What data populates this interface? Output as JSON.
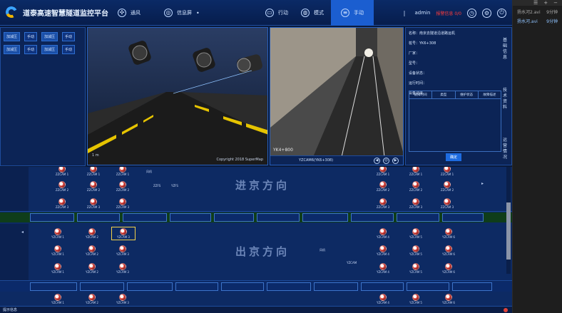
{
  "header": {
    "title": "道泰高速智慧隧道监控平台",
    "nav": [
      {
        "icon": "fan-icon",
        "label": "通风"
      },
      {
        "icon": "target-icon",
        "label": "信息屏"
      }
    ],
    "nav_right": [
      {
        "icon": "monitor-icon",
        "label": "行动"
      },
      {
        "icon": "globe-icon",
        "label": "模式"
      },
      {
        "icon": "sliders-icon",
        "label": "手动"
      }
    ],
    "user": "admin",
    "alert_text": "报警信息 0/0",
    "accent": "#1b5ed0"
  },
  "side_panel": {
    "files": [
      {
        "name": "扬水河2.avi",
        "size": "9分钟"
      },
      {
        "name": "扬水河.avi",
        "size": "9分钟"
      }
    ]
  },
  "left_panel": {
    "rows": [
      {
        "a": "加减压",
        "b": "手动",
        "c": "加减压",
        "d": "手动"
      },
      {
        "a": "加减压",
        "b": "手动",
        "c": "加减压",
        "d": "手动"
      }
    ]
  },
  "view3d": {
    "credit": "Copyright 2018 SuperMap",
    "scale": "1 m"
  },
  "camera": {
    "overlay": "YK4+800",
    "caption": "YZCAM6(YK6+308)",
    "buttons": [
      "◀",
      "◎",
      "▶"
    ]
  },
  "info": {
    "fields": [
      "名称：南京去隧道沿道路运机",
      "桩号：YK6+308",
      "厂家：",
      "型号：",
      "设备状态：",
      "运行时间：",
      "设备记录"
    ],
    "table_headers": [
      "故障时间",
      "类型",
      "维护状态",
      "故障描述"
    ],
    "confirm": "确定",
    "tabs": [
      "基础信息",
      "技术资料",
      "运营情况"
    ]
  },
  "schematic": {
    "dir_in": "进京方向",
    "dir_out": "出京方向",
    "devices_row1": [
      "ZZCAM 1",
      "ZZCAM 1",
      "ZZCAM 1",
      "ZZCAM 1",
      "ZZCAM 1",
      "ZZCAM 1"
    ],
    "devices_row2": [
      "ZZCAM 2",
      "ZZCAM 2",
      "ZZCAM 2",
      "ZZCAM 2",
      "ZZCAM 2",
      "ZZCAM 2"
    ],
    "devices_row3": [
      "ZZCAM 3",
      "ZZCAM 3",
      "ZZCAM 3",
      "ZZCAM 3",
      "ZZCAM 3",
      "ZZCAM 3"
    ],
    "devices_row4": [
      "YZCAM 1",
      "YZCAM 2",
      "YZCAM 3",
      "YZCAM 4",
      "YZCAM 5",
      "YZCAM 6"
    ],
    "devices_row5": [
      "YZCAM 1",
      "YZCAM 2",
      "YZCAM 3",
      "YZCAM 4",
      "YZCAM 5",
      "YZCAM 6"
    ],
    "devices_row6": [
      "YZCAM 1",
      "YZCAM 2",
      "YZCAM 3",
      "YZCAM 4",
      "YZCAM 5",
      "YZCAM 6"
    ],
    "devices_row7": [
      "YZCAM 1",
      "YZCAM 2",
      "YZCAM 3",
      "YZCAM 4",
      "YZCAM 5",
      "YZCAM 6"
    ],
    "small_labels": [
      "风机",
      "ZZFS",
      "YZFS",
      "YZCAM",
      "风机"
    ]
  },
  "status": {
    "label": "提示信息"
  }
}
